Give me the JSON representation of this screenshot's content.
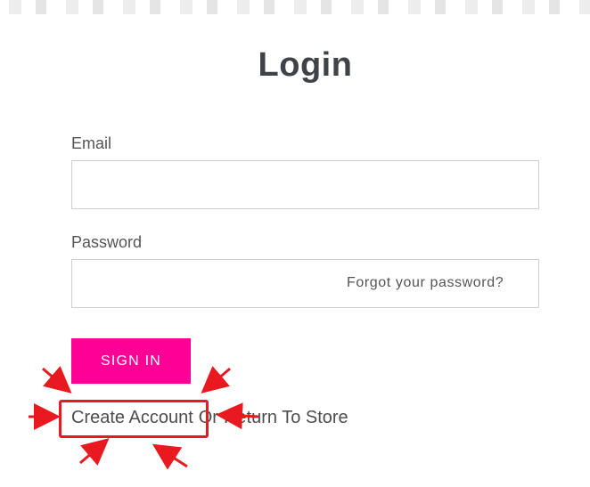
{
  "page": {
    "title": "Login"
  },
  "form": {
    "email_label": "Email",
    "email_value": "",
    "password_label": "Password",
    "password_value": "",
    "forgot_link": "Forgot your password?",
    "sign_in_button": "SIGN IN"
  },
  "links": {
    "create_account": "Create Account",
    "separator": "Or",
    "return_to_store": "Return To Store"
  },
  "annotation": {
    "highlight_color": "#e8191f",
    "button_color": "#ff0096"
  }
}
